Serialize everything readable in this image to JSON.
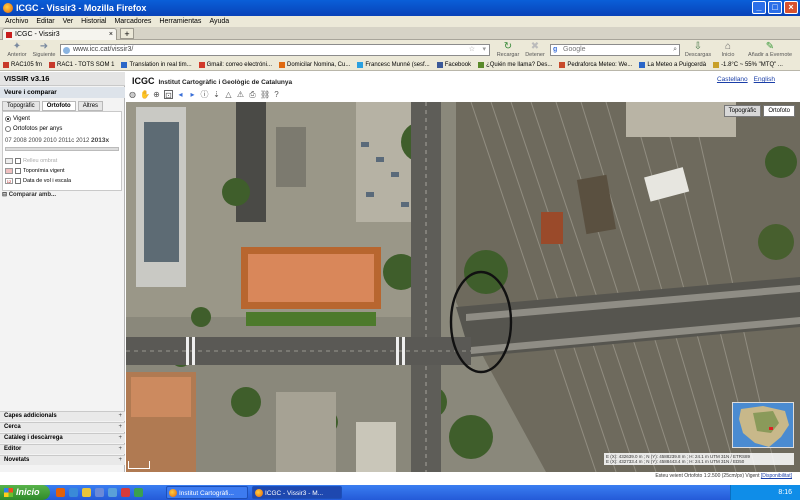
{
  "window": {
    "title": "ICGC - Vissir3 - Mozilla Firefox"
  },
  "menu": [
    "Archivo",
    "Editar",
    "Ver",
    "Historial",
    "Marcadores",
    "Herramientas",
    "Ayuda"
  ],
  "tab": {
    "label": "ICGC - Vissir3",
    "close": "×",
    "new": "+"
  },
  "nav": {
    "back": "Anterior",
    "forward": "Siguiente",
    "url": "www.icc.cat/vissir3/",
    "reload": "Recargar",
    "stop": "Detener",
    "search_placeholder": "Google",
    "downloads": "Descargas",
    "home": "Inicio",
    "evernote": "Añadir a Evernote"
  },
  "bookmarks": [
    {
      "label": "RAC105 fm",
      "color": "#c83a2a"
    },
    {
      "label": "RAC1 - TOTS SOM 1",
      "color": "#c83a2a"
    },
    {
      "label": "Translation in real tim...",
      "color": "#2a66c8"
    },
    {
      "label": "Gmail: correo electróni...",
      "color": "#d23a2a"
    },
    {
      "label": "Domicilar Nomina, Cu...",
      "color": "#e06a10"
    },
    {
      "label": "Francesc Munné (sesf...",
      "color": "#2aa0e0"
    },
    {
      "label": "Facebook",
      "color": "#3b5998"
    },
    {
      "label": "¿Quién me llama? Des...",
      "color": "#5a8a2a"
    },
    {
      "label": "Pedraforca Meteo: We...",
      "color": "#c84a2a"
    },
    {
      "label": "La Meteo a Puigcerdà",
      "color": "#2a66c8"
    },
    {
      "label": "-1.8°C ~ 55% \"MTQ\" ...",
      "color": "#c8a02a"
    }
  ],
  "sidebar": {
    "title": "VISSIR v3.16",
    "subtitle": "Veure i comparar",
    "tabs": [
      "Topogràfic",
      "Ortofoto",
      "Altres"
    ],
    "radios": [
      "Vigent",
      "Ortofotos per anys"
    ],
    "years": "07 2008 2009 2010 2011c 2012",
    "year_selected": "2013x",
    "layers": [
      "Relleu ombrat",
      "Toponímia vigent",
      "Data de vol i escala"
    ],
    "compare": "Comparar amb...",
    "sections": [
      "Capes addicionals",
      "Cerca",
      "Catàleg i descàrrega",
      "Editor",
      "Novetats"
    ]
  },
  "header": {
    "logo": "ICGC",
    "institute": "Institut Cartogràfic i Geològic de Catalunya",
    "lang1": "Castellano",
    "lang2": "English"
  },
  "map": {
    "tabs": [
      "Topogràfic",
      "Ortofoto"
    ],
    "coord1": "E (X): 432639.0 m ; N (Y): 4588239.8 m ; H: 24.1 m UTM 31N / ETRS89",
    "coord2": "E (X): 432733.4 m ; N (Y): 4588443.4 m ; H: 24.1 m UTM 31N / ED50"
  },
  "status": {
    "text": "Esteu veient Ortofoto 1:2.500 (25cm/px) Vigent",
    "link": "[Disponibilitat]"
  },
  "taskbar": {
    "start": "Inicio",
    "tasks": [
      "Institut Cartogràfi...",
      "ICGC - Vissir3 - M..."
    ],
    "clock": "8:16"
  }
}
